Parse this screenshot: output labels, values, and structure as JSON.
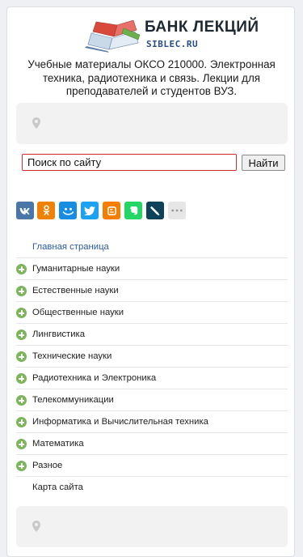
{
  "header": {
    "logo_title": "БАНК ЛЕКЦИЙ",
    "logo_subtitle": "SIBLEC.RU",
    "tagline": "Учебные материалы ОКСО 210000. Электронная техника, радиотехника и связь. Лекции для преподавателей и студентов ВУЗ."
  },
  "search": {
    "input_value": "Поиск по сайту",
    "button_label": "Найти"
  },
  "social": [
    {
      "name": "vk-icon",
      "color": "#4a76a8",
      "glyph": "vk"
    },
    {
      "name": "odnoklassniki-icon",
      "color": "#ee8208",
      "glyph": "ok"
    },
    {
      "name": "moimir-icon",
      "color": "#168de2",
      "glyph": "mm"
    },
    {
      "name": "twitter-icon",
      "color": "#1da1f2",
      "glyph": "tw"
    },
    {
      "name": "blogger-icon",
      "color": "#f57d00",
      "glyph": "bl"
    },
    {
      "name": "evernote-icon",
      "color": "#24d666",
      "glyph": "ev"
    },
    {
      "name": "livejournal-icon",
      "color": "#0d425a",
      "glyph": "lj"
    },
    {
      "name": "more-icon",
      "color": "#e6e6e6",
      "glyph": "more"
    }
  ],
  "nav": {
    "home": "Главная страница",
    "items": [
      "Гуманитарные науки",
      "Естественные науки",
      "Общественные науки",
      "Лингвистика",
      "Технические науки",
      "Радиотехника и Электроника",
      "Телекоммуникации",
      "Информатика и Вычислительная техника",
      "Математика",
      "Разное"
    ],
    "sitemap": "Карта сайта"
  },
  "colors": {
    "accent": "#2c5aa0",
    "search_border": "#c9302c",
    "plus_green": "#7bb65a"
  }
}
